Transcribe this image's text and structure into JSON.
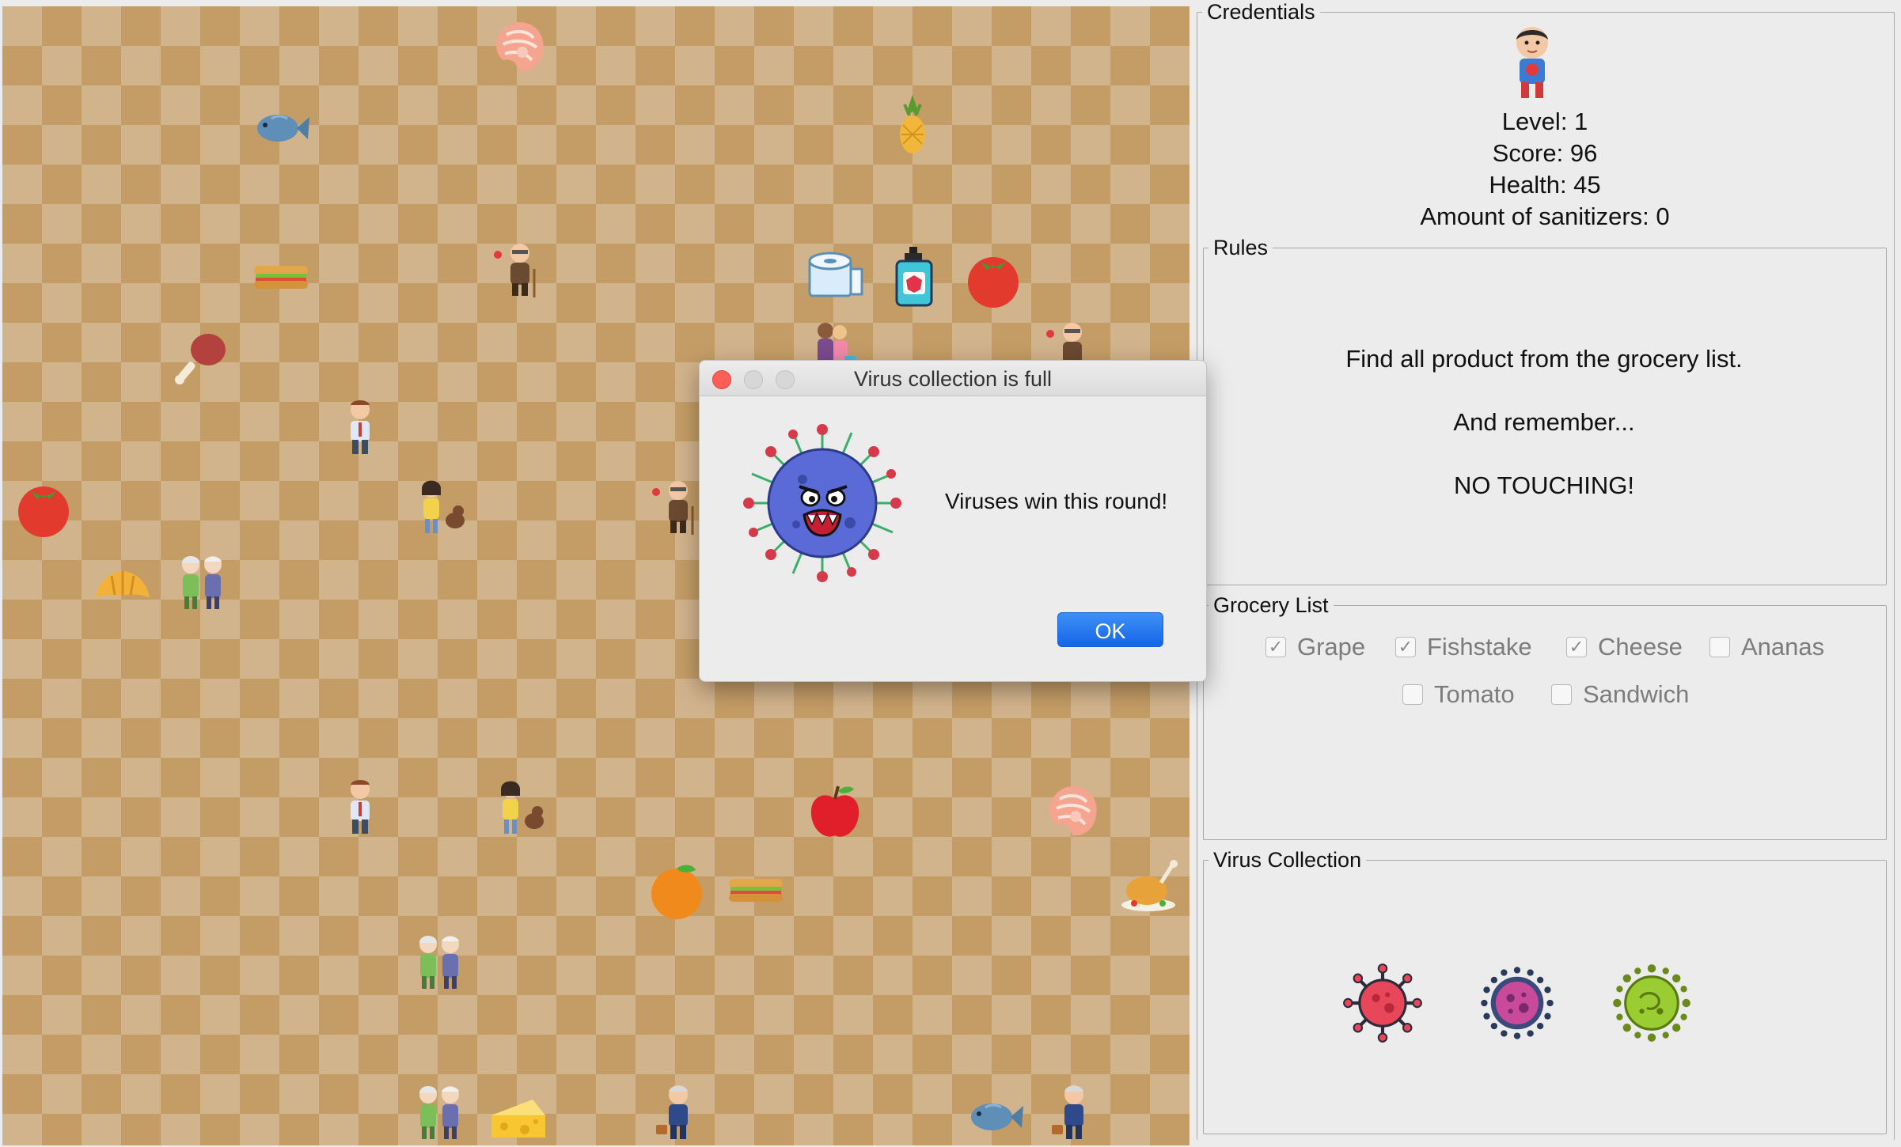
{
  "board": {
    "sprites": [
      {
        "icon": "salmon-steak-icon"
      },
      {
        "icon": "fish-icon"
      },
      {
        "icon": "pineapple-icon"
      },
      {
        "icon": "sandwich-icon"
      },
      {
        "icon": "old-man-with-cane-icon"
      },
      {
        "icon": "toilet-paper-icon"
      },
      {
        "icon": "hand-sanitizer-icon"
      },
      {
        "icon": "tomato-icon"
      },
      {
        "icon": "meat-leg-icon"
      },
      {
        "icon": "shopping-women-icon"
      },
      {
        "icon": "old-man-with-cane-icon"
      },
      {
        "icon": "businessman-icon"
      },
      {
        "icon": "tomato-icon"
      },
      {
        "icon": "girl-with-dog-icon"
      },
      {
        "icon": "old-man-with-cane-icon"
      },
      {
        "icon": "croissant-icon"
      },
      {
        "icon": "elderly-couple-icon"
      },
      {
        "icon": "businessman-icon"
      },
      {
        "icon": "girl-with-dog-icon"
      },
      {
        "icon": "apple-icon"
      },
      {
        "icon": "salmon-steak-icon"
      },
      {
        "icon": "orange-icon"
      },
      {
        "icon": "sandwich-icon"
      },
      {
        "icon": "roast-chicken-icon"
      },
      {
        "icon": "elderly-couple-icon"
      },
      {
        "icon": "elderly-couple-icon"
      },
      {
        "icon": "cheese-icon"
      },
      {
        "icon": "old-man-with-suitcase-icon"
      },
      {
        "icon": "fish-icon"
      },
      {
        "icon": "old-man-with-suitcase-icon"
      }
    ]
  },
  "credentials": {
    "title": "Credentials",
    "avatar_icon": "boy-with-mask-avatar-icon",
    "level": "Level: 1",
    "score": "Score: 96",
    "health": "Health:  45",
    "sanitizers": "Amount of sanitizers: 0"
  },
  "rules": {
    "title": "Rules",
    "line1": "Find all product from the grocery list.",
    "line2": "And remember...",
    "line3": "NO TOUCHING!"
  },
  "grocery": {
    "title": "Grocery List",
    "items": [
      {
        "label": "Grape",
        "checked": true
      },
      {
        "label": "Fishstake",
        "checked": true
      },
      {
        "label": "Cheese",
        "checked": true
      },
      {
        "label": "Ananas",
        "checked": false
      },
      {
        "label": "Tomato",
        "checked": false
      },
      {
        "label": "Sandwich",
        "checked": false
      }
    ]
  },
  "virus_collection": {
    "title": "Virus Collection",
    "viruses": [
      {
        "icon": "red-virus-icon",
        "color": "#e8475a"
      },
      {
        "icon": "purple-virus-icon",
        "color": "#c94a9a"
      },
      {
        "icon": "green-virus-icon",
        "color": "#9acd32"
      }
    ]
  },
  "dialog": {
    "title": "Virus collection is full",
    "icon": "angry-virus-icon",
    "message": "Viruses win this round!",
    "ok_label": "OK"
  }
}
